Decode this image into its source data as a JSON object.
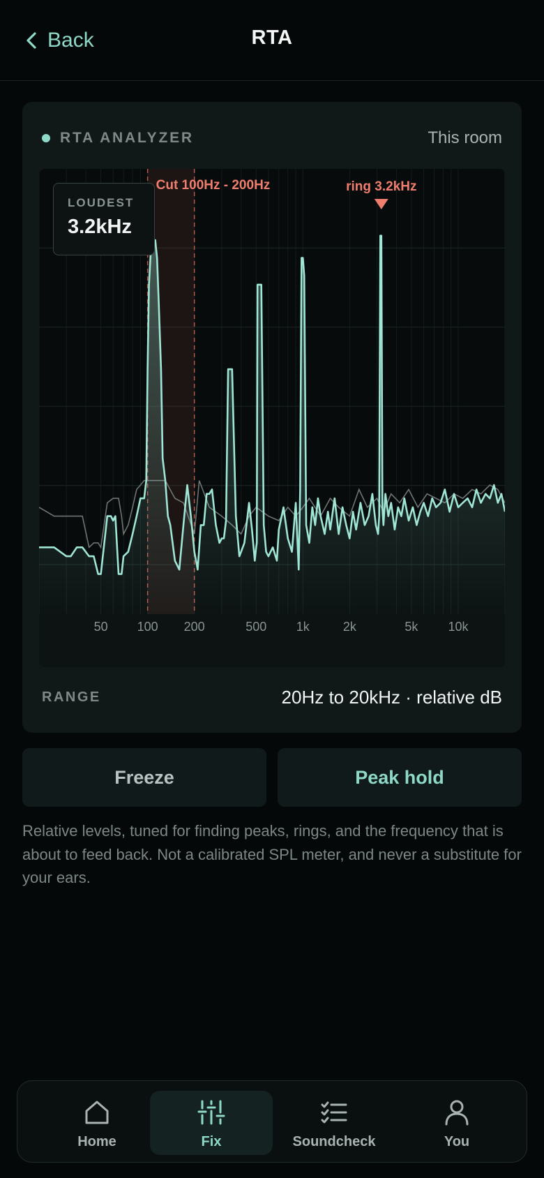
{
  "header": {
    "back_label": "Back",
    "title": "RTA"
  },
  "card": {
    "title": "RTA ANALYZER",
    "scope": "This room",
    "loudest_label": "LOUDEST",
    "loudest_value": "3.2kHz",
    "cut_annotation": "Cut 100Hz - 200Hz",
    "ring_annotation": "ring 3.2kHz",
    "range_label": "RANGE",
    "range_value": "20Hz to 20kHz · relative dB"
  },
  "buttons": {
    "freeze": "Freeze",
    "peak_hold": "Peak hold"
  },
  "note": "Relative levels, tuned for finding peaks, rings, and the frequency that is about to feed back. Not a calibrated SPL meter, and never a substitute for your ears.",
  "nav": {
    "items": [
      {
        "label": "Home",
        "icon": "home-icon",
        "active": false
      },
      {
        "label": "Fix",
        "icon": "sliders-icon",
        "active": true
      },
      {
        "label": "Soundcheck",
        "icon": "checklist-icon",
        "active": false
      },
      {
        "label": "You",
        "icon": "user-icon",
        "active": false
      }
    ]
  },
  "colors": {
    "accent": "#8fd9c9",
    "warn": "#f07e6e",
    "background": "#050808",
    "card": "#111818"
  },
  "chart_data": {
    "type": "area",
    "x_scale": "log",
    "x_unit": "Hz",
    "xlim": [
      20,
      20000
    ],
    "ylim": [
      0,
      100
    ],
    "x_ticks": [
      {
        "value": 50,
        "label": "50"
      },
      {
        "value": 100,
        "label": "100"
      },
      {
        "value": 200,
        "label": "200"
      },
      {
        "value": 500,
        "label": "500"
      },
      {
        "value": 1000,
        "label": "1k"
      },
      {
        "value": 2000,
        "label": "2k"
      },
      {
        "value": 5000,
        "label": "5k"
      },
      {
        "value": 10000,
        "label": "10k"
      }
    ],
    "cut_band": [
      100,
      200
    ],
    "ring_marker": 3200,
    "series": [
      {
        "role": "live",
        "x": [
          20,
          25,
          30,
          32,
          35,
          38,
          42,
          45,
          48,
          50,
          55,
          58,
          60,
          62,
          65,
          68,
          70,
          75,
          80,
          85,
          90,
          95,
          98,
          100,
          102,
          105,
          108,
          112,
          115,
          118,
          122,
          125,
          130,
          135,
          140,
          150,
          160,
          170,
          180,
          190,
          200,
          205,
          210,
          215,
          220,
          230,
          240,
          250,
          260,
          275,
          290,
          300,
          310,
          320,
          330,
          350,
          370,
          390,
          400,
          420,
          450,
          470,
          490,
          500,
          505,
          510,
          520,
          540,
          560,
          580,
          600,
          640,
          680,
          700,
          750,
          800,
          850,
          900,
          940,
          960,
          980,
          1000,
          1020,
          1050,
          1100,
          1150,
          1200,
          1250,
          1300,
          1380,
          1450,
          1500,
          1600,
          1700,
          1800,
          1900,
          2000,
          2100,
          2200,
          2350,
          2500,
          2650,
          2800,
          2950,
          3050,
          3100,
          3150,
          3200,
          3250,
          3300,
          3400,
          3550,
          3700,
          3900,
          4100,
          4300,
          4500,
          4800,
          5100,
          5400,
          5700,
          6000,
          6400,
          6800,
          7200,
          7700,
          8200,
          8800,
          9400,
          10000,
          10700,
          11500,
          12300,
          13100,
          14000,
          15000,
          16000,
          17000,
          18000,
          19000,
          20000
        ],
        "y": [
          15,
          15,
          13,
          13,
          15,
          15,
          13,
          13,
          9,
          9,
          22,
          22,
          21,
          22,
          9,
          9,
          13,
          14,
          18,
          22,
          26,
          26,
          30,
          55,
          74,
          82,
          84,
          84,
          80,
          70,
          55,
          35,
          30,
          22,
          20,
          12,
          10,
          20,
          29,
          22,
          14,
          12,
          10,
          15,
          20,
          20,
          27,
          27,
          28,
          20,
          16,
          17,
          17,
          21,
          55,
          55,
          22,
          13,
          14,
          16,
          25,
          19,
          12,
          15,
          16,
          74,
          74,
          74,
          20,
          14,
          13,
          15,
          12,
          19,
          24,
          17,
          14,
          25,
          10,
          28,
          80,
          80,
          76,
          20,
          16,
          24,
          20,
          26,
          22,
          18,
          23,
          19,
          26,
          18,
          24,
          20,
          17,
          23,
          19,
          25,
          20,
          22,
          27,
          20,
          18,
          22,
          85,
          85,
          24,
          20,
          27,
          22,
          25,
          19,
          24,
          22,
          26,
          21,
          24,
          20,
          23,
          25,
          22,
          26,
          24,
          25,
          28,
          23,
          27,
          24,
          25,
          26,
          24,
          28,
          25,
          27,
          26,
          29,
          25,
          27,
          23
        ]
      },
      {
        "role": "hold",
        "x": [
          20,
          25,
          30,
          35,
          38,
          42,
          45,
          48,
          50,
          55,
          60,
          65,
          68,
          70,
          75,
          80,
          85,
          90,
          95,
          100,
          110,
          130,
          150,
          170,
          200,
          215,
          250,
          300,
          350,
          400,
          450,
          500,
          600,
          700,
          800,
          900,
          1000,
          1100,
          1300,
          1500,
          1700,
          2000,
          2300,
          2600,
          3000,
          3300,
          3700,
          4200,
          4800,
          5500,
          6300,
          7200,
          8200,
          9400,
          10700,
          12300,
          14000,
          16000,
          18000,
          20000
        ],
        "y": [
          24,
          22,
          22,
          22,
          22,
          15,
          16,
          16,
          15,
          25,
          26,
          26,
          22,
          18,
          20,
          24,
          28,
          29,
          30,
          30,
          30,
          30,
          26,
          25,
          18,
          30,
          24,
          22,
          20,
          18,
          22,
          24,
          22,
          21,
          24,
          22,
          24,
          26,
          22,
          26,
          24,
          22,
          28,
          24,
          26,
          23,
          27,
          25,
          28,
          24,
          27,
          26,
          25,
          27,
          26,
          28,
          27,
          29,
          28,
          25
        ]
      }
    ]
  }
}
